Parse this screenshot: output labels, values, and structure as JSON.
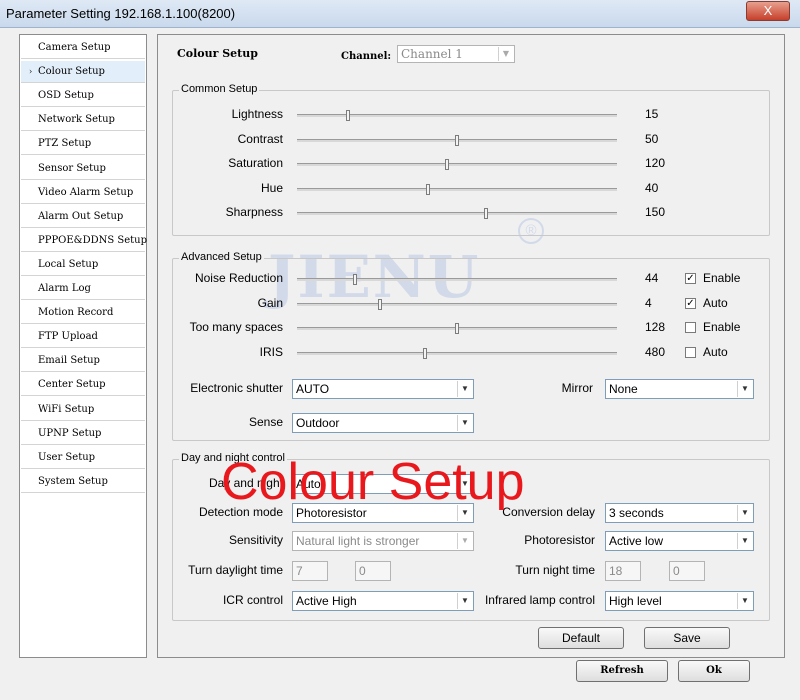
{
  "window": {
    "title": "Parameter Setting 192.168.1.100(8200)",
    "close_label": "X"
  },
  "sidebar": {
    "items": [
      {
        "label": "Camera Setup"
      },
      {
        "label": "Colour Setup",
        "active": true
      },
      {
        "label": "OSD Setup"
      },
      {
        "label": "Network Setup"
      },
      {
        "label": "PTZ Setup"
      },
      {
        "label": "Sensor Setup"
      },
      {
        "label": "Video Alarm Setup"
      },
      {
        "label": "Alarm Out Setup"
      },
      {
        "label": "PPPOE&DDNS Setup"
      },
      {
        "label": "Local Setup"
      },
      {
        "label": "Alarm Log"
      },
      {
        "label": "Motion Record"
      },
      {
        "label": "FTP Upload"
      },
      {
        "label": "Email Setup"
      },
      {
        "label": "Center Setup"
      },
      {
        "label": "WiFi Setup"
      },
      {
        "label": "UPNP Setup"
      },
      {
        "label": "User Setup"
      },
      {
        "label": "System Setup"
      }
    ]
  },
  "header": {
    "title": "Colour Setup",
    "channel_label": "Channel:",
    "channel_value": "Channel 1"
  },
  "common": {
    "title": "Common Setup",
    "sliders": [
      {
        "label": "Lightness",
        "value": "15",
        "level": 0.16
      },
      {
        "label": "Contrast",
        "value": "50",
        "level": 0.5
      },
      {
        "label": "Saturation",
        "value": "120",
        "level": 0.47
      },
      {
        "label": "Hue",
        "value": "40",
        "level": 0.41
      },
      {
        "label": "Sharpness",
        "value": "150",
        "level": 0.59
      }
    ]
  },
  "advanced": {
    "title": "Advanced Setup",
    "sliders": [
      {
        "label": "Noise Reduction",
        "value": "44",
        "level": 0.18,
        "check_label": "Enable",
        "checked": true
      },
      {
        "label": "Gain",
        "value": "4",
        "level": 0.26,
        "check_label": "Auto",
        "checked": true
      },
      {
        "label": "Too many  spaces",
        "value": "128",
        "level": 0.5,
        "check_label": "Enable",
        "checked": false
      },
      {
        "label": "IRIS",
        "value": "480",
        "level": 0.4,
        "check_label": "Auto",
        "checked": false
      }
    ],
    "shutter_label": "Electronic shutter",
    "shutter_value": "AUTO",
    "mirror_label": "Mirror",
    "mirror_value": "None",
    "sense_label": "Sense",
    "sense_value": "Outdoor"
  },
  "daynight": {
    "title": "Day and night control",
    "daynight_label": "Day and night",
    "daynight_value": "Auto",
    "detection_label": "Detection mode",
    "detection_value": "Photoresistor",
    "conversion_label": "Conversion delay",
    "conversion_value": "3 seconds",
    "sensitivity_label": "Sensitivity",
    "sensitivity_value": "Natural light is stronger",
    "photoresistor_label": "Photoresistor",
    "photoresistor_value": "Active low",
    "daylight_label": "Turn daylight time",
    "daylight_h": "7",
    "daylight_m": "0",
    "night_label": "Turn night time",
    "night_h": "18",
    "night_m": "0",
    "icr_label": "ICR control",
    "icr_value": "Active High",
    "infrared_label": "Infrared lamp control",
    "infrared_value": "High level"
  },
  "buttons": {
    "default": "Default",
    "save": "Save",
    "refresh": "Refresh",
    "ok": "Ok"
  },
  "overlay_text": "Colour Setup",
  "watermark": {
    "text": "JIENU",
    "registered": "®"
  }
}
